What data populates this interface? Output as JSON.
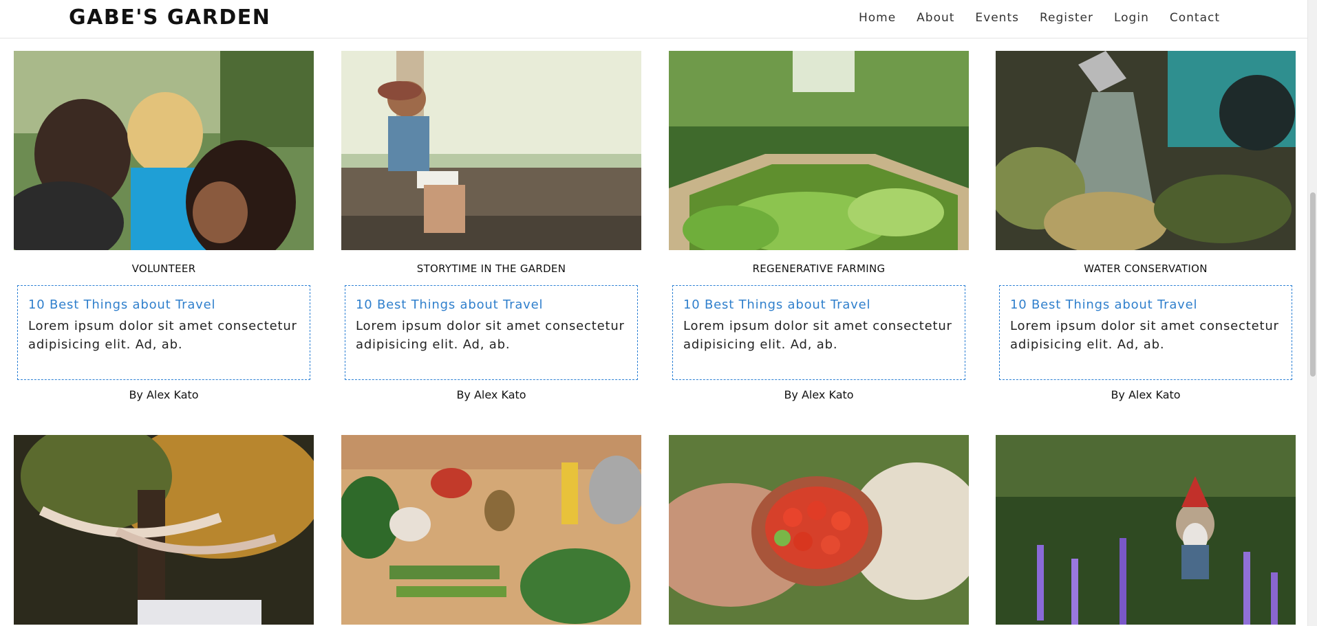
{
  "header": {
    "brand": "GABE'S GARDEN",
    "nav": [
      "Home",
      "About",
      "Events",
      "Register",
      "Login",
      "Contact"
    ]
  },
  "cards": [
    {
      "title": "VOLUNTEER",
      "headline": "10 Best Things about Travel",
      "body": "Lorem ipsum dolor sit amet consectetur adipisicing elit. Ad, ab.",
      "author": "By Alex Kato"
    },
    {
      "title": "STORYTIME IN THE GARDEN",
      "headline": "10 Best Things about Travel",
      "body": "Lorem ipsum dolor sit amet consectetur adipisicing elit. Ad, ab.",
      "author": "By Alex Kato"
    },
    {
      "title": "REGENERATIVE FARMING",
      "headline": "10 Best Things about Travel",
      "body": "Lorem ipsum dolor sit amet consectetur adipisicing elit. Ad, ab.",
      "author": "By Alex Kato"
    },
    {
      "title": "WATER CONSERVATION",
      "headline": "10 Best Things about Travel",
      "body": "Lorem ipsum dolor sit amet consectetur adipisicing elit. Ad, ab.",
      "author": "By Alex Kato"
    }
  ],
  "photos": {
    "row1": [
      "children-reading-photo",
      "laughing-boy-bench-photo",
      "raised-garden-bed-photo",
      "watering-can-plants-photo"
    ],
    "row2": [
      "tree-bunting-party-photo",
      "vegetables-table-photo",
      "tomato-bowl-hands-photo",
      "gnome-lavender-photo"
    ]
  }
}
